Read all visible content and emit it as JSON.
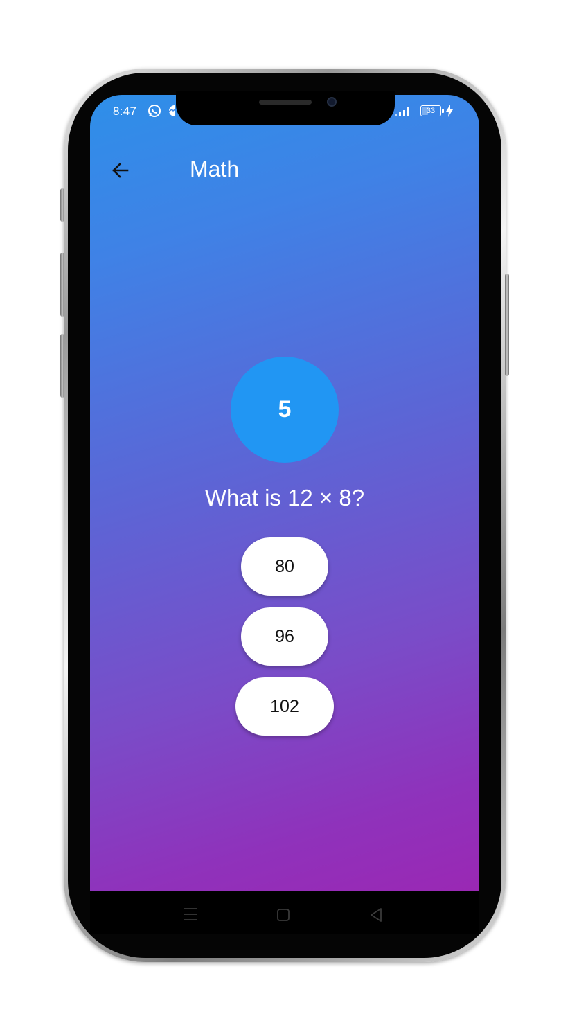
{
  "status_bar": {
    "time": "8:47",
    "battery_level": "33",
    "icons": [
      "whatsapp-icon",
      "messenger-icon",
      "signal-icon",
      "battery-icon",
      "charging-icon"
    ]
  },
  "app_bar": {
    "title": "Math",
    "back_icon": "arrow-left-icon"
  },
  "quiz": {
    "timer_value": "5",
    "question": "What is 12 × 8?",
    "answers": [
      {
        "label": "80"
      },
      {
        "label": "96"
      },
      {
        "label": "102"
      }
    ]
  },
  "navigation_bar": {
    "icons": [
      "menu-icon",
      "home-icon",
      "back-icon"
    ]
  },
  "colors": {
    "gradient_top": "#2e8fe9",
    "gradient_bottom": "#9a28b4",
    "timer_circle": "#2196f3",
    "answer_button": "#ffffff"
  }
}
